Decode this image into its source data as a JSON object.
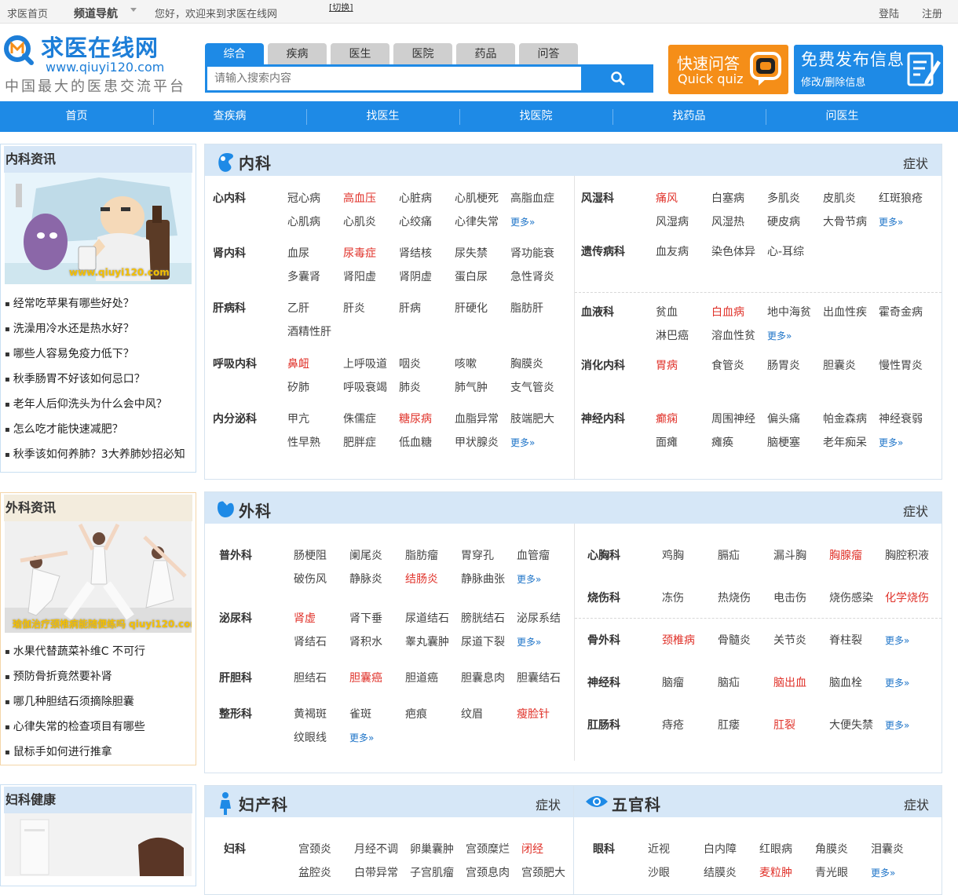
{
  "topbar": {
    "home": "求医首页",
    "channel_nav": "频道导航",
    "welcome": "您好，欢迎来到求医在线网",
    "switch": "[切换]",
    "login": "登陆",
    "register": "注册"
  },
  "logo": {
    "name": "求医在线网",
    "url": "www.qiuyi120.com",
    "slogan": "中国最大的医患交流平台"
  },
  "search": {
    "tabs": [
      "综合",
      "疾病",
      "医生",
      "医院",
      "药品",
      "问答"
    ],
    "placeholder": "请输入搜索内容"
  },
  "quiz": {
    "title": "快速问答",
    "subtitle": "Quick quiz"
  },
  "publish": {
    "title": "免费发布信息",
    "subtitle": "修改/删除信息"
  },
  "mainnav": [
    "首页",
    "查疾病",
    "找医生",
    "找医院",
    "找药品",
    "问医生"
  ],
  "news": [
    {
      "title": "内科资讯",
      "caption": "www.qiuyi120.com",
      "items": [
        "经常吃苹果有哪些好处？",
        "洗澡用冷水还是热水好？",
        "哪些人容易免疫力低下？",
        "秋季肠胃不好该如何忌口？",
        "老年人后仰洗头为什么会中风？",
        "怎么吃才能快速减肥？",
        "秋季该如何养肺？3大养肺妙招必知"
      ]
    },
    {
      "title": "外科资讯",
      "caption": "瑜伽治疗颈椎病能随便练吗 qiuyi120.com",
      "items": [
        "水果代替蔬菜补维C 不可行",
        "预防骨折竟然要补肾",
        "哪几种胆结石须摘除胆囊",
        "心律失常的检查项目有哪些",
        "鼠标手如何进行推拿"
      ]
    },
    {
      "title": "妇科健康",
      "items": []
    }
  ],
  "symptom_label": "症状",
  "more_label": "更多»",
  "panels": {
    "neike": {
      "title": "内科",
      "left": [
        {
          "name": "心内科",
          "items": [
            "冠心病",
            "高血压",
            "心脏病",
            "心肌梗死",
            "高脂血症",
            "心肌病",
            "心肌炎",
            "心绞痛",
            "心律失常"
          ],
          "hot": [
            1
          ],
          "more": true
        },
        {
          "name": "肾内科",
          "items": [
            "血尿",
            "尿毒症",
            "肾结核",
            "尿失禁",
            "肾功能衰",
            "多囊肾",
            "肾阳虚",
            "肾阴虚",
            "蛋白尿",
            "急性肾炎"
          ],
          "hot": [
            1
          ],
          "more": false
        },
        {
          "name": "肝病科",
          "items": [
            "乙肝",
            "肝炎",
            "肝病",
            "肝硬化",
            "脂肪肝",
            "酒精性肝"
          ],
          "hot": [],
          "more": false
        },
        {
          "name": "呼吸内科",
          "items": [
            "鼻衄",
            "上呼吸道",
            "咽炎",
            "咳嗽",
            "胸膜炎",
            "矽肺",
            "呼吸衰竭",
            "肺炎",
            "肺气肿",
            "支气管炎"
          ],
          "hot": [
            0
          ],
          "more": false
        },
        {
          "name": "内分泌科",
          "items": [
            "甲亢",
            "侏儒症",
            "糖尿病",
            "血脂异常",
            "肢端肥大",
            "性早熟",
            "肥胖症",
            "低血糖",
            "甲状腺炎"
          ],
          "hot": [
            2
          ],
          "more": true
        }
      ],
      "right": [
        {
          "name": "风湿科",
          "items": [
            "痛风",
            "白塞病",
            "多肌炎",
            "皮肌炎",
            "红斑狼疮",
            "风湿病",
            "风湿热",
            "硬皮病",
            "大骨节病"
          ],
          "hot": [
            0
          ],
          "more": true
        },
        {
          "name": "遗传病科",
          "items": [
            "血友病",
            "染色体异",
            "心-耳综"
          ],
          "hot": [],
          "more": false
        },
        {
          "name": "血液科",
          "items": [
            "贫血",
            "白血病",
            "地中海贫",
            "出血性疾",
            "霍奇金病",
            "淋巴癌",
            "溶血性贫"
          ],
          "hot": [
            1
          ],
          "more": true
        },
        {
          "name": "消化内科",
          "items": [
            "胃病",
            "食管炎",
            "肠胃炎",
            "胆囊炎",
            "慢性胃炎"
          ],
          "hot": [
            0
          ],
          "more": false
        },
        {
          "name": "神经内科",
          "items": [
            "癫痫",
            "周围神经",
            "偏头痛",
            "帕金森病",
            "神经衰弱",
            "面瘫",
            "瘫痪",
            "脑梗塞",
            "老年痴呆"
          ],
          "hot": [
            0
          ],
          "more": true
        }
      ]
    },
    "waike": {
      "title": "外科",
      "left": [
        {
          "name": "普外科",
          "items": [
            "肠梗阻",
            "阑尾炎",
            "脂肪瘤",
            "胃穿孔",
            "血管瘤",
            "破伤风",
            "静脉炎",
            "结肠炎",
            "静脉曲张"
          ],
          "hot": [
            7
          ],
          "more": true
        },
        {
          "name": "泌尿科",
          "items": [
            "肾虚",
            "肾下垂",
            "尿道结石",
            "膀胱结石",
            "泌尿系结",
            "肾结石",
            "肾积水",
            "睾丸囊肿",
            "尿道下裂"
          ],
          "hot": [
            0
          ],
          "more": true
        },
        {
          "name": "肝胆科",
          "items": [
            "胆结石",
            "胆囊癌",
            "胆道癌",
            "胆囊息肉",
            "胆囊结石"
          ],
          "hot": [
            1
          ],
          "more": false
        },
        {
          "name": "整形科",
          "items": [
            "黄褐斑",
            "雀斑",
            "疤痕",
            "纹眉",
            "瘦脸针",
            "纹眼线"
          ],
          "hot": [
            4
          ],
          "more": true
        }
      ],
      "right": [
        {
          "name": "心胸科",
          "items": [
            "鸡胸",
            "膈疝",
            "漏斗胸",
            "胸腺瘤",
            "胸腔积液"
          ],
          "hot": [
            3
          ],
          "more": false
        },
        {
          "name": "烧伤科",
          "items": [
            "冻伤",
            "热烧伤",
            "电击伤",
            "烧伤感染",
            "化学烧伤"
          ],
          "hot": [
            4
          ],
          "more": false
        },
        {
          "name": "骨外科",
          "items": [
            "颈椎病",
            "骨髓炎",
            "关节炎",
            "脊柱裂"
          ],
          "hot": [
            0
          ],
          "more": true
        },
        {
          "name": "神经科",
          "items": [
            "脑瘤",
            "脑疝",
            "脑出血",
            "脑血栓"
          ],
          "hot": [
            2
          ],
          "more": true
        },
        {
          "name": "肛肠科",
          "items": [
            "痔疮",
            "肛瘘",
            "肛裂",
            "大便失禁"
          ],
          "hot": [
            2
          ],
          "more": true
        }
      ]
    },
    "fuchan": {
      "title": "妇产科",
      "groups": [
        {
          "name": "妇科",
          "items": [
            "宫颈炎",
            "月经不调",
            "卵巢囊肿",
            "宫颈糜烂",
            "闭经",
            "盆腔炎",
            "白带异常",
            "子宫肌瘤",
            "宫颈息肉",
            "宫颈肥大"
          ],
          "hot": [
            4
          ],
          "more": false
        }
      ]
    },
    "wuguan": {
      "title": "五官科",
      "groups": [
        {
          "name": "眼科",
          "items": [
            "近视",
            "白内障",
            "红眼病",
            "角膜炎",
            "泪囊炎",
            "沙眼",
            "结膜炎",
            "麦粒肿",
            "青光眼"
          ],
          "hot": [
            7
          ],
          "more": true
        }
      ]
    }
  }
}
